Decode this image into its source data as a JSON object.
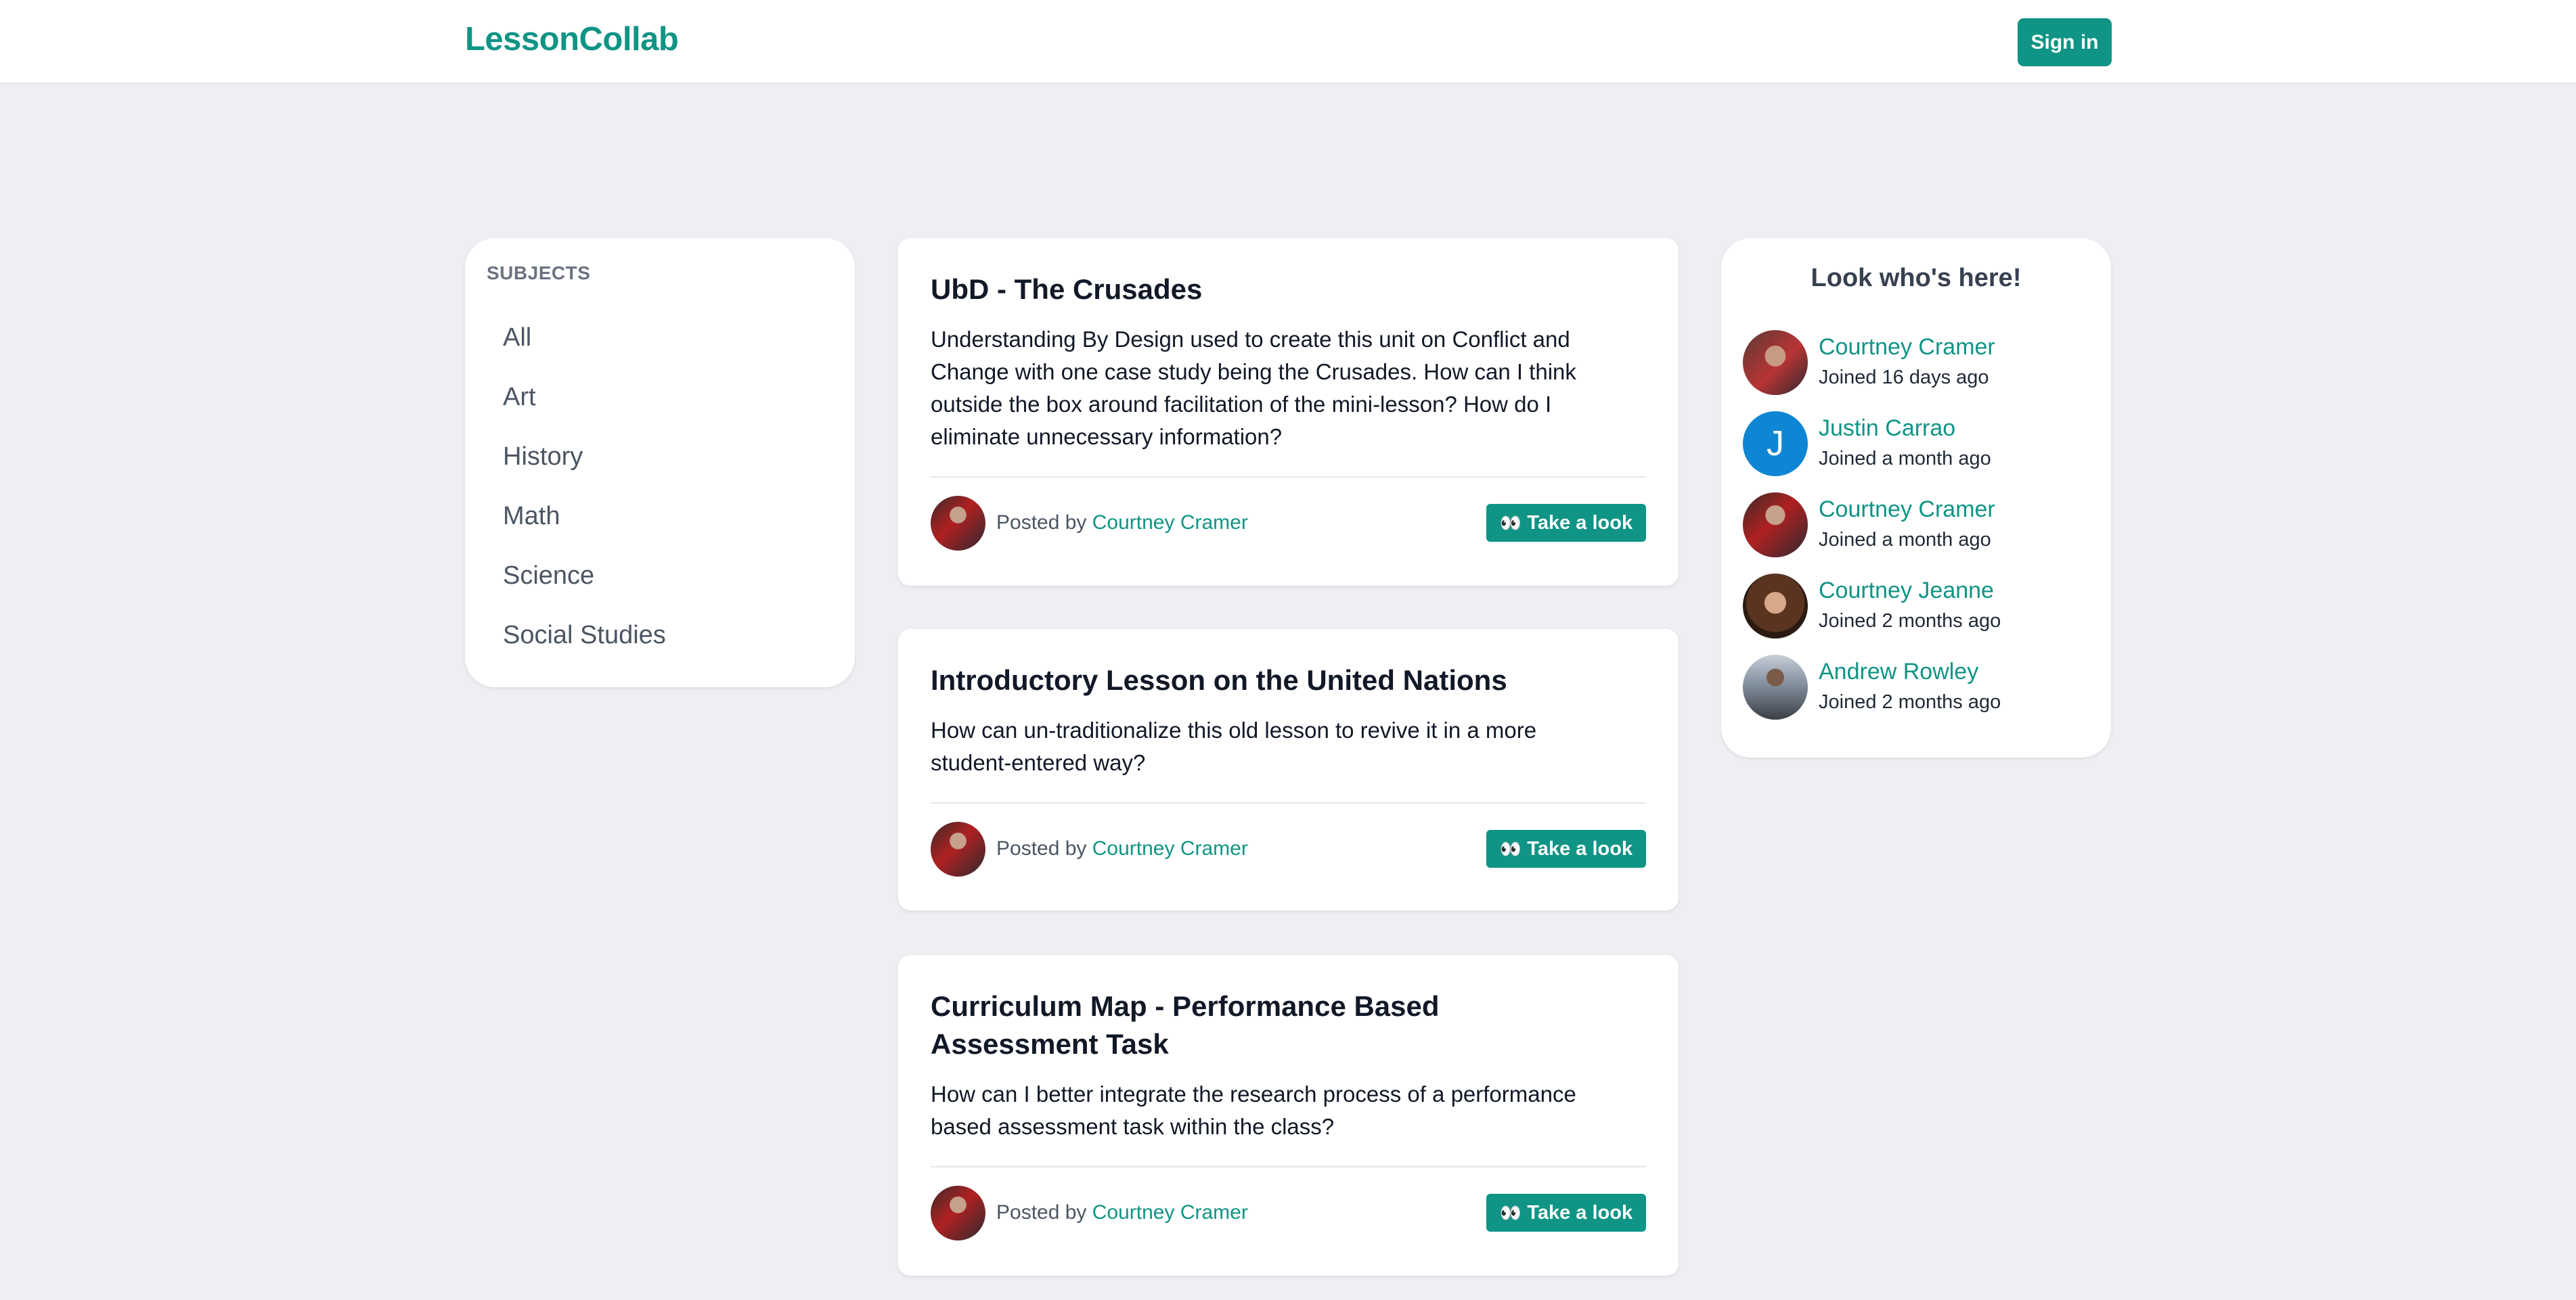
{
  "app": {
    "logo": "LessonCollab",
    "sign_in_label": "Sign in"
  },
  "subjects": {
    "title": "SUBJECTS",
    "items": [
      "All",
      "Art",
      "History",
      "Math",
      "Science",
      "Social Studies"
    ]
  },
  "posts": [
    {
      "title": "UbD - The Crusades",
      "body": "Understanding By Design used to create this unit on Conflict and Change with one case study being the Crusades. How can I think outside the box around facilitation of the mini-lesson? How do I eliminate unnecessary information?",
      "posted_by_label": "Posted by",
      "author": "Courtney Cramer",
      "action_label": "Take a look"
    },
    {
      "title": "Introductory Lesson on the United Nations",
      "body": "How can un-traditionalize this old lesson to revive it in a more student-entered way?",
      "posted_by_label": "Posted by",
      "author": "Courtney Cramer",
      "action_label": "Take a look"
    },
    {
      "title": "Curriculum Map - Performance Based Assessment Task",
      "body": "How can I better integrate the research process of a performance based assessment task within the class?",
      "posted_by_label": "Posted by",
      "author": "Courtney Cramer",
      "action_label": "Take a look"
    }
  ],
  "who": {
    "title": "Look who's here!",
    "members": [
      {
        "name": "Courtney Cramer",
        "joined": "Joined 16 days ago"
      },
      {
        "name": "Justin Carrao",
        "joined": "Joined a month ago",
        "initial": "J"
      },
      {
        "name": "Courtney Cramer",
        "joined": "Joined a month ago"
      },
      {
        "name": "Courtney Jeanne",
        "joined": "Joined 2 months ago"
      },
      {
        "name": "Andrew Rowley",
        "joined": "Joined 2 months ago"
      }
    ]
  },
  "colors": {
    "brand": "#0f9485",
    "background": "#eeeff3",
    "avatar_initial_bg": "#0e86d4"
  }
}
